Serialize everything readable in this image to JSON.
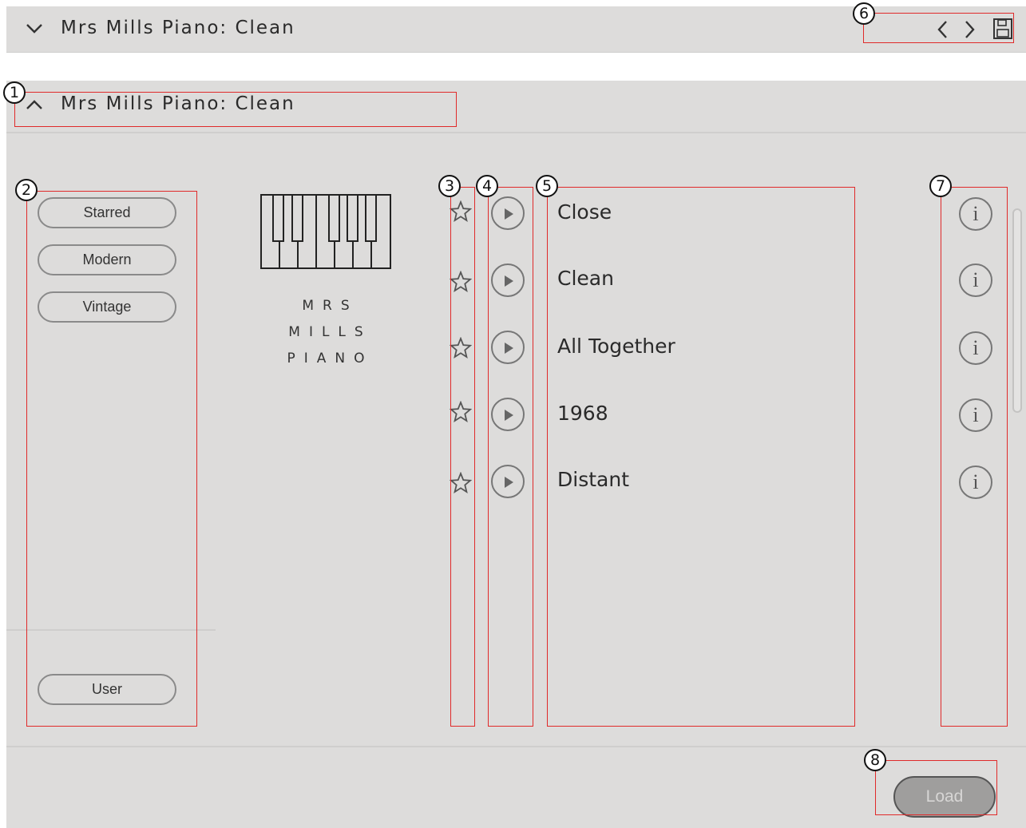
{
  "header": {
    "title": "Mrs Mills Piano: Clean",
    "icons": [
      "chevron-down-icon",
      "chevron-left-icon",
      "chevron-right-icon",
      "save-icon"
    ]
  },
  "browser": {
    "title": "Mrs Mills Piano: Clean",
    "categories": [
      "Starred",
      "Modern",
      "Vintage"
    ],
    "user_label": "User",
    "brand": {
      "line1": "MRS",
      "line2": "MILLS",
      "line3": "PIANO"
    },
    "presets": [
      {
        "name": "Close"
      },
      {
        "name": "Clean"
      },
      {
        "name": "All Together"
      },
      {
        "name": "1968"
      },
      {
        "name": "Distant"
      }
    ],
    "load_label": "Load"
  },
  "annotations": [
    "1",
    "2",
    "3",
    "4",
    "5",
    "6",
    "7",
    "8"
  ],
  "colors": {
    "annotation": "#e02a2a",
    "panel": "#dddcdb"
  }
}
